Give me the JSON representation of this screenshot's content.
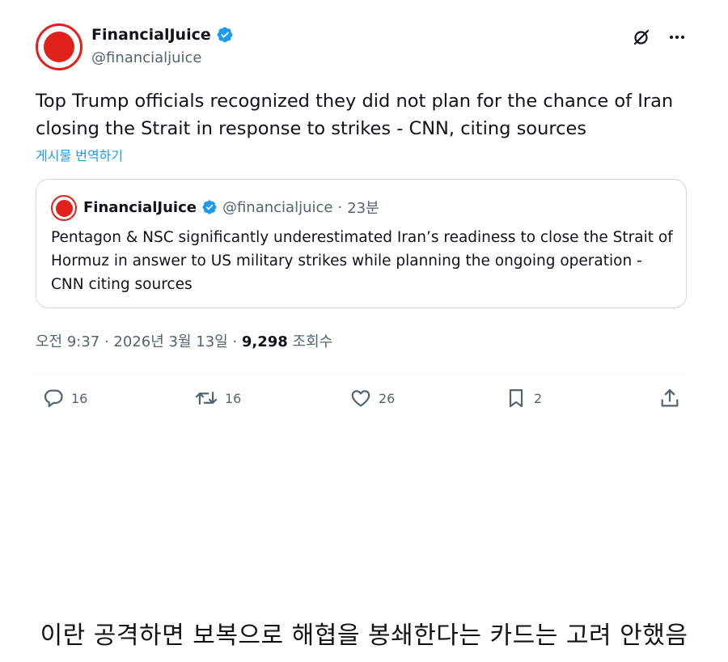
{
  "tweet": {
    "display_name": "FinancialJuice",
    "handle": "@financialjuice",
    "text": "Top Trump officials recognized they did not plan for the chance of Iran closing the Strait in response to strikes - CNN, citing sources",
    "translate_label": "게시물 번역하기",
    "timestamp": "오전 9:37 · 2026년 3월 13일 · ",
    "views_count": "9,298",
    "views_label": " 조회수"
  },
  "quote": {
    "display_name": "FinancialJuice",
    "handle": "@financialjuice",
    "separator": "·",
    "time": "23분",
    "text": "Pentagon & NSC significantly underestimated Iran’s readiness to close the Strait of Hormuz in answer to US military strikes while planning the ongoing operation - CNN citing sources"
  },
  "actions": {
    "replies": "16",
    "reposts": "16",
    "likes": "26",
    "bookmarks": "2"
  },
  "caption": "이란 공격하면 보복으로 해협을 봉쇄한다는 카드는 고려 안했음",
  "colors": {
    "brand_red": "#e0221a",
    "verified_blue": "#1d9bf0",
    "secondary_text": "#536471"
  },
  "icons": [
    "verified-badge-icon",
    "grok-icon",
    "more-icon",
    "reply-icon",
    "repost-icon",
    "like-icon",
    "bookmark-icon",
    "share-icon"
  ]
}
